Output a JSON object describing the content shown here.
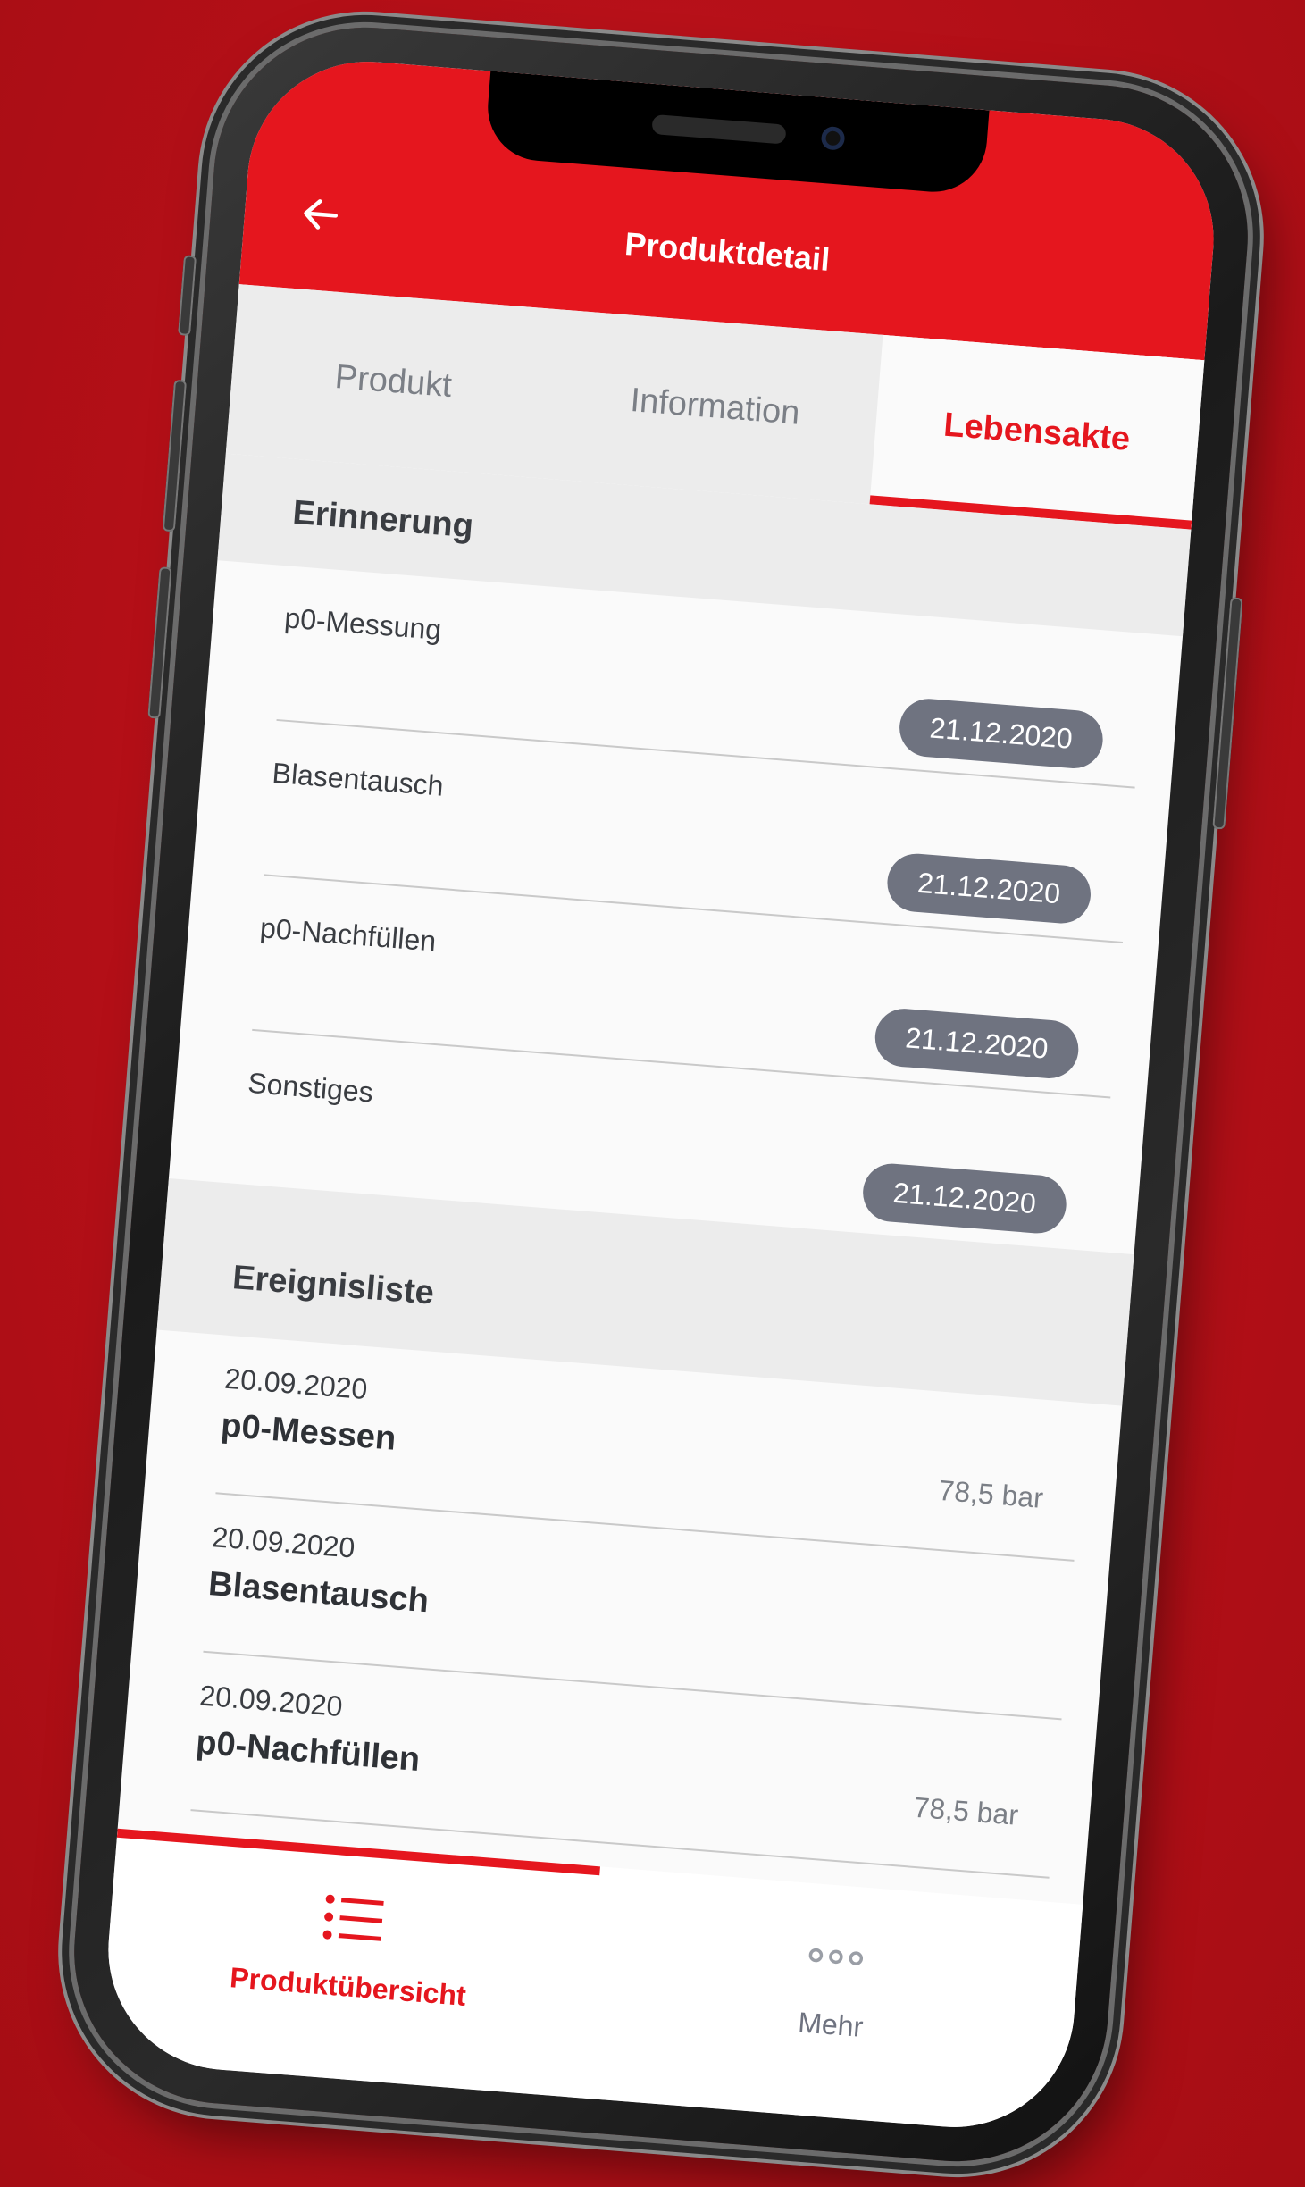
{
  "header": {
    "title": "Produktdetail"
  },
  "tabs": [
    {
      "label": "Produkt",
      "active": false
    },
    {
      "label": "Information",
      "active": false
    },
    {
      "label": "Lebensakte",
      "active": true
    }
  ],
  "reminders": {
    "title": "Erinnerung",
    "items": [
      {
        "label": "p0-Messung",
        "date": "21.12.2020"
      },
      {
        "label": "Blasentausch",
        "date": "21.12.2020"
      },
      {
        "label": "p0-Nachfüllen",
        "date": "21.12.2020"
      },
      {
        "label": "Sonstiges",
        "date": "21.12.2020"
      }
    ]
  },
  "events": {
    "title": "Ereignisliste",
    "items": [
      {
        "date": "20.09.2020",
        "title": "p0-Messen",
        "value": "78,5 bar"
      },
      {
        "date": "20.09.2020",
        "title": "Blasentausch",
        "value": ""
      },
      {
        "date": "20.09.2020",
        "title": "p0-Nachfüllen",
        "value": "78,5 bar"
      }
    ]
  },
  "bottom_nav": [
    {
      "label": "Produktübersicht",
      "icon": "list-icon",
      "active": true
    },
    {
      "label": "Mehr",
      "icon": "more-dots-icon",
      "active": false
    }
  ],
  "colors": {
    "accent": "#e5161e",
    "chip": "#6f7380",
    "background": "#b8121a"
  }
}
